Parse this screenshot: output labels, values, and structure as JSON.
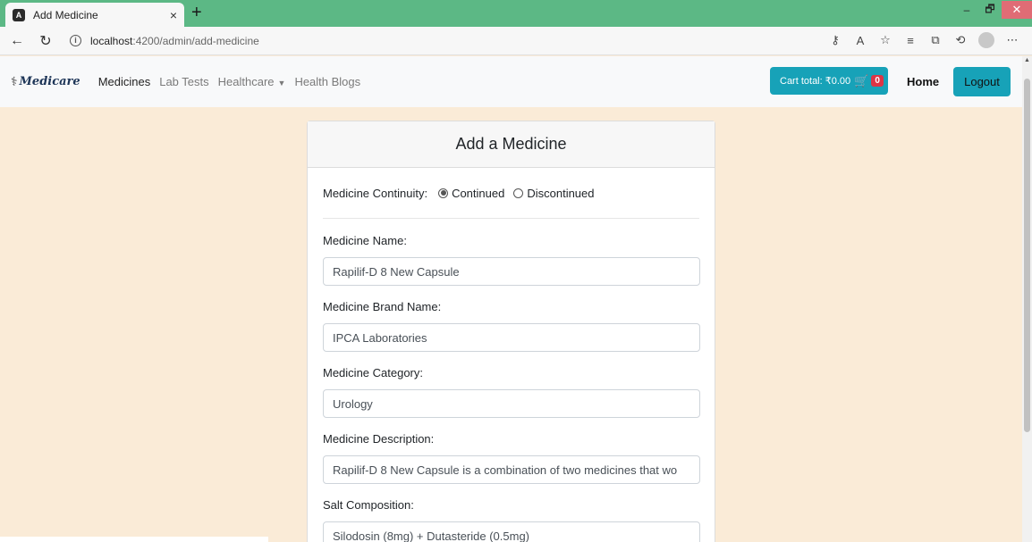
{
  "browser": {
    "tab_title": "Add Medicine",
    "tab_close": "×",
    "new_tab": "+",
    "url_host": "localhost",
    "url_path": ":4200/admin/add-medicine",
    "win_minimize": "–",
    "win_restore": "🗗",
    "win_close": "✕"
  },
  "navbar": {
    "brand": "Medicare",
    "links": [
      "Medicines",
      "Lab Tests",
      "Healthcare",
      "Health Blogs"
    ],
    "cart_label": "Cart total: ₹0.00",
    "cart_count": "0",
    "home": "Home",
    "logout": "Logout"
  },
  "form": {
    "title": "Add a Medicine",
    "continuity_label": "Medicine Continuity:",
    "continuity_options": [
      "Continued",
      "Discontinued"
    ],
    "continuity_selected": "Continued",
    "fields": [
      {
        "label": "Medicine Name:",
        "value": "Rapilif-D 8 New Capsule"
      },
      {
        "label": "Medicine Brand Name:",
        "value": "IPCA Laboratories"
      },
      {
        "label": "Medicine Category:",
        "value": "Urology"
      },
      {
        "label": "Medicine Description:",
        "value": "Rapilif-D 8 New Capsule is a combination of two medicines that wo"
      },
      {
        "label": "Salt Composition:",
        "value": "Silodosin (8mg) + Dutasteride (0.5mg)"
      }
    ]
  },
  "colors": {
    "tabstrip": "#5cb885",
    "page_bg": "#faebd7",
    "accent": "#17a2b8",
    "badge": "#dc3545"
  },
  "icons": [
    "back-arrow-icon",
    "refresh-icon",
    "info-icon",
    "read-aloud-icon",
    "favorites-icon",
    "collections-icon",
    "history-icon",
    "cart-icon"
  ]
}
